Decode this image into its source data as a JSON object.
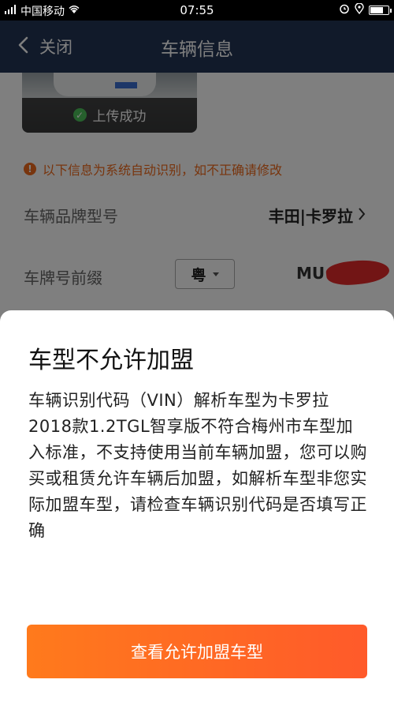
{
  "status_bar": {
    "carrier": "中国移动",
    "time": "07:55",
    "battery_level": 0.8
  },
  "nav": {
    "back_label": "关闭",
    "title": "车辆信息"
  },
  "photo": {
    "upload_status": "上传成功"
  },
  "notice": {
    "text": "以下信息为系统自动识别，如不正确请修改"
  },
  "vehicle": {
    "brand_label": "车辆品牌型号",
    "brand_value": "丰田|卡罗拉",
    "plate_prefix_label": "车牌号前缀",
    "plate_prefix_value": "粤",
    "plate_number": "MU"
  },
  "dialog": {
    "title": "车型不允许加盟",
    "message": "车辆识别代码（VIN）解析车型为卡罗拉2018款1.2TGL智享版不符合梅州市车型加入标准，不支持使用当前车辆加盟，您可以购买或租赁允许车辆后加盟，如解析车型非您实际加盟车型，请检查车辆识别代码是否填写正确",
    "button_label": "查看允许加盟车型"
  },
  "colors": {
    "nav_bg": "#233555",
    "accent": "#ff6a24",
    "notice": "#f06a1c",
    "success": "#4cc05a"
  }
}
